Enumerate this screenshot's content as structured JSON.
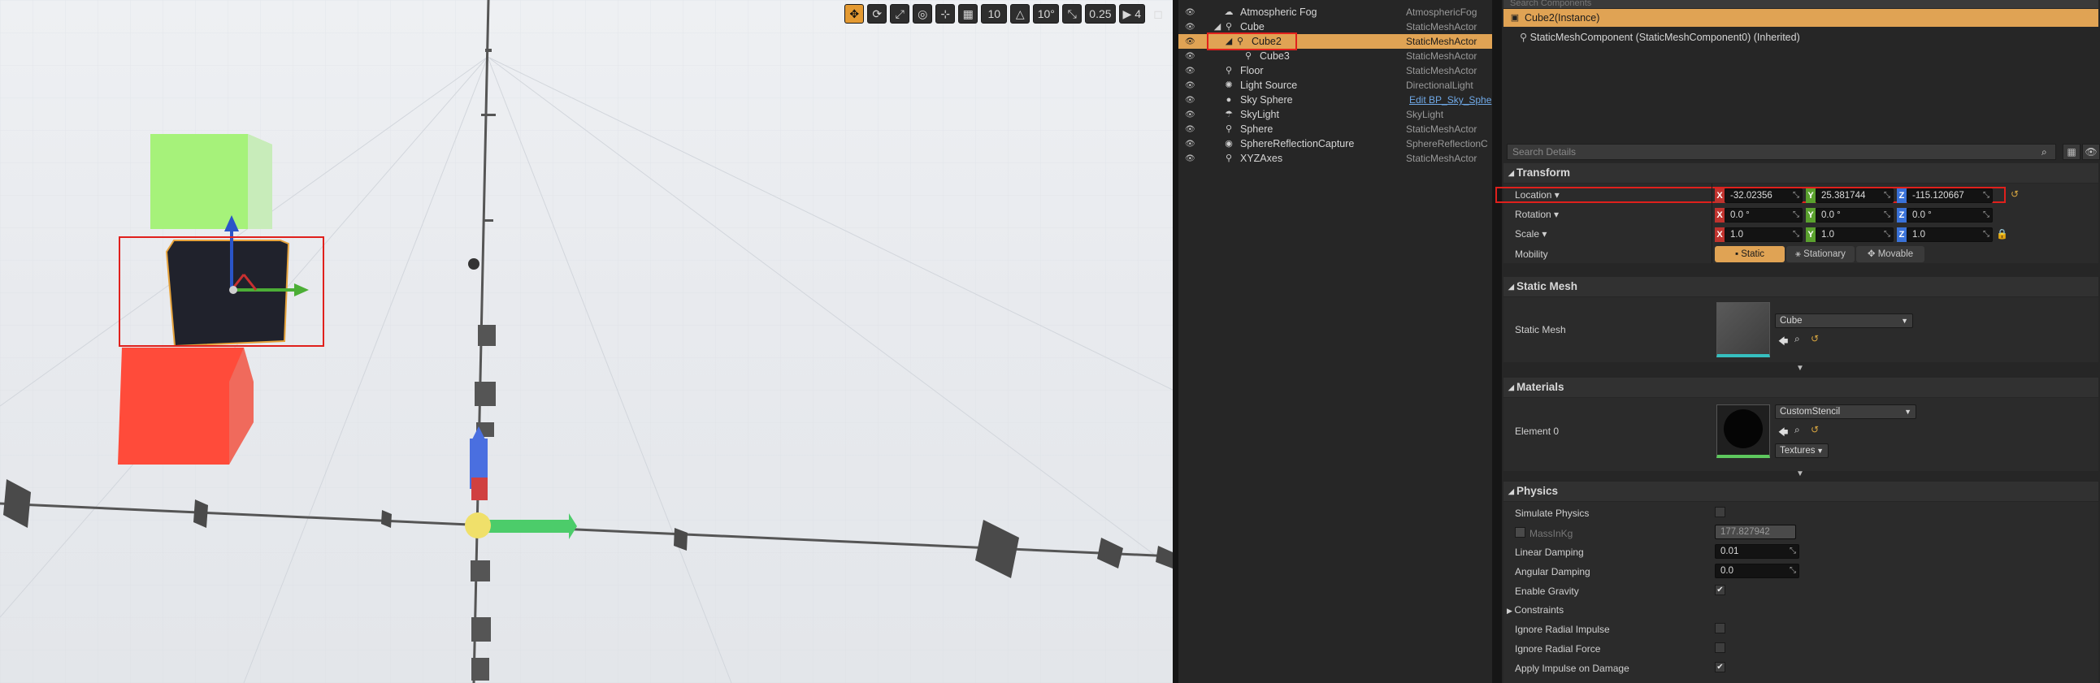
{
  "toolbar": {
    "grid_snap": "10",
    "rotation_snap": "10°",
    "scale_snap": "0.25",
    "camera_speed": "4"
  },
  "outliner": {
    "rows": [
      {
        "label": "Atmospheric Fog",
        "type": "AtmosphericFog"
      },
      {
        "label": "Cube",
        "type": "StaticMeshActor"
      },
      {
        "label": "Cube2",
        "type": "StaticMeshActor"
      },
      {
        "label": "Cube3",
        "type": "StaticMeshActor"
      },
      {
        "label": "Floor",
        "type": "StaticMeshActor"
      },
      {
        "label": "Light Source",
        "type": "DirectionalLight"
      },
      {
        "label": "Sky Sphere",
        "type": "Edit BP_Sky_Sphe"
      },
      {
        "label": "SkyLight",
        "type": "SkyLight"
      },
      {
        "label": "Sphere",
        "type": "StaticMeshActor"
      },
      {
        "label": "SphereReflectionCapture",
        "type": "SphereReflectionC"
      },
      {
        "label": "XYZAxes",
        "type": "StaticMeshActor"
      }
    ]
  },
  "components": {
    "search_placeholder": "Search Components",
    "selected": "Cube2(Instance)",
    "child": "StaticMeshComponent (StaticMeshComponent0) (Inherited)"
  },
  "details": {
    "search_placeholder": "Search Details",
    "transform": {
      "title": "Transform",
      "location_label": "Location",
      "location": {
        "x": "-32.02356",
        "y": "25.381744",
        "z": "-115.120667"
      },
      "rotation_label": "Rotation",
      "rotation": {
        "x": "0.0 °",
        "y": "0.0 °",
        "z": "0.0 °"
      },
      "scale_label": "Scale",
      "scale": {
        "x": "1.0",
        "y": "1.0",
        "z": "1.0"
      },
      "mobility_label": "Mobility",
      "mobility_options": [
        "Static",
        "Stationary",
        "Movable"
      ],
      "mobility_selected": "Static"
    },
    "static_mesh": {
      "title": "Static Mesh",
      "label": "Static Mesh",
      "value": "Cube"
    },
    "materials": {
      "title": "Materials",
      "element_label": "Element 0",
      "value": "CustomStencil",
      "textures_button": "Textures"
    },
    "physics": {
      "title": "Physics",
      "simulate_physics": "Simulate Physics",
      "simulate_physics_checked": false,
      "mass_label": "MassInKg",
      "mass_value": "177.827942",
      "linear_damping_label": "Linear Damping",
      "linear_damping": "0.01",
      "angular_damping_label": "Angular Damping",
      "angular_damping": "0.0",
      "enable_gravity": "Enable Gravity",
      "enable_gravity_checked": true,
      "constraints": "Constraints",
      "ignore_radial_impulse": "Ignore Radial Impulse",
      "ignore_radial_force": "Ignore Radial Force",
      "apply_impulse": "Apply Impulse on Damage",
      "apply_impulse_checked": true
    }
  },
  "colors": {
    "selection": "#e0a354",
    "highlight": "#e0201c",
    "axis_x": "#c0332e",
    "axis_y": "#5aa12e",
    "axis_z": "#3a72d8"
  }
}
